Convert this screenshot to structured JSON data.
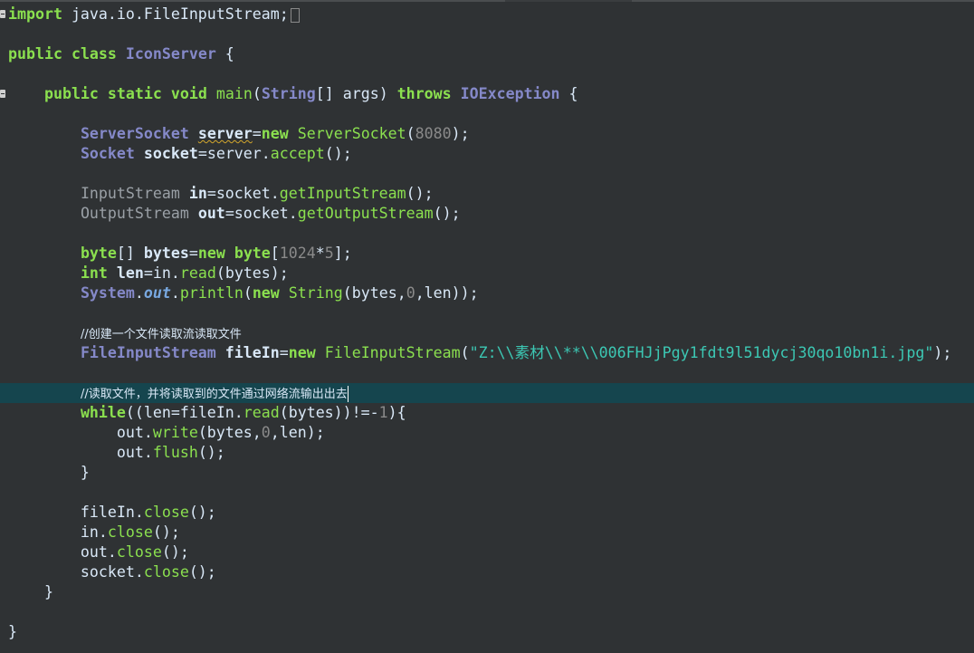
{
  "colors": {
    "background": "#2f3234",
    "keyword": "#8be04f",
    "type": "#8589c9",
    "string": "#3cc8b4",
    "current_line": "#15454e",
    "text": "#d9e8f7"
  },
  "editor": {
    "lines": [
      {
        "tokens": [
          {
            "t": "import",
            "c": "kw"
          },
          {
            "t": " java.io.FileInputStream;",
            "c": "id"
          }
        ],
        "collapsed": true,
        "fold": true
      },
      {
        "tokens": []
      },
      {
        "tokens": [
          {
            "t": "public",
            "c": "kw"
          },
          {
            "t": " ",
            "c": "id"
          },
          {
            "t": "class",
            "c": "kw"
          },
          {
            "t": " ",
            "c": "id"
          },
          {
            "t": "IconServer",
            "c": "typeb"
          },
          {
            "t": " {",
            "c": "id"
          }
        ]
      },
      {
        "tokens": []
      },
      {
        "tokens": [
          {
            "t": "    ",
            "c": "id"
          },
          {
            "t": "public",
            "c": "kw"
          },
          {
            "t": " ",
            "c": "id"
          },
          {
            "t": "static",
            "c": "kw"
          },
          {
            "t": " ",
            "c": "id"
          },
          {
            "t": "void",
            "c": "kw"
          },
          {
            "t": " ",
            "c": "id"
          },
          {
            "t": "main",
            "c": "meth"
          },
          {
            "t": "(",
            "c": "id"
          },
          {
            "t": "String",
            "c": "typeb"
          },
          {
            "t": "[] args) ",
            "c": "id"
          },
          {
            "t": "throws",
            "c": "kw"
          },
          {
            "t": " ",
            "c": "id"
          },
          {
            "t": "IOException",
            "c": "typeb"
          },
          {
            "t": " {",
            "c": "id"
          }
        ],
        "fold": true
      },
      {
        "tokens": []
      },
      {
        "tokens": [
          {
            "t": "        ",
            "c": "id"
          },
          {
            "t": "ServerSocket",
            "c": "typeb"
          },
          {
            "t": " ",
            "c": "id"
          },
          {
            "t": "server",
            "c": "idb",
            "squig": true
          },
          {
            "t": "=",
            "c": "id"
          },
          {
            "t": "new",
            "c": "kw"
          },
          {
            "t": " ",
            "c": "id"
          },
          {
            "t": "ServerSocket",
            "c": "meth"
          },
          {
            "t": "(",
            "c": "id"
          },
          {
            "t": "8080",
            "c": "num"
          },
          {
            "t": ");",
            "c": "id"
          }
        ]
      },
      {
        "tokens": [
          {
            "t": "        ",
            "c": "id"
          },
          {
            "t": "Socket",
            "c": "typeb"
          },
          {
            "t": " ",
            "c": "id"
          },
          {
            "t": "socket",
            "c": "idb"
          },
          {
            "t": "=server.",
            "c": "id"
          },
          {
            "t": "accept",
            "c": "meth"
          },
          {
            "t": "();",
            "c": "id"
          }
        ]
      },
      {
        "tokens": []
      },
      {
        "tokens": [
          {
            "t": "        ",
            "c": "id"
          },
          {
            "t": "InputStream",
            "c": "grey"
          },
          {
            "t": " ",
            "c": "id"
          },
          {
            "t": "in",
            "c": "idb"
          },
          {
            "t": "=socket.",
            "c": "id"
          },
          {
            "t": "getInputStream",
            "c": "meth"
          },
          {
            "t": "();",
            "c": "id"
          }
        ]
      },
      {
        "tokens": [
          {
            "t": "        ",
            "c": "id"
          },
          {
            "t": "OutputStream",
            "c": "grey"
          },
          {
            "t": " ",
            "c": "id"
          },
          {
            "t": "out",
            "c": "idb"
          },
          {
            "t": "=socket.",
            "c": "id"
          },
          {
            "t": "getOutputStream",
            "c": "meth"
          },
          {
            "t": "();",
            "c": "id"
          }
        ]
      },
      {
        "tokens": []
      },
      {
        "tokens": [
          {
            "t": "        ",
            "c": "id"
          },
          {
            "t": "byte",
            "c": "kw"
          },
          {
            "t": "[] ",
            "c": "id"
          },
          {
            "t": "bytes",
            "c": "idb"
          },
          {
            "t": "=",
            "c": "id"
          },
          {
            "t": "new",
            "c": "kw"
          },
          {
            "t": " ",
            "c": "id"
          },
          {
            "t": "byte",
            "c": "kw"
          },
          {
            "t": "[",
            "c": "id"
          },
          {
            "t": "1024",
            "c": "num"
          },
          {
            "t": "*",
            "c": "id"
          },
          {
            "t": "5",
            "c": "num"
          },
          {
            "t": "];",
            "c": "id"
          }
        ]
      },
      {
        "tokens": [
          {
            "t": "        ",
            "c": "id"
          },
          {
            "t": "int",
            "c": "kw"
          },
          {
            "t": " ",
            "c": "id"
          },
          {
            "t": "len",
            "c": "idb"
          },
          {
            "t": "=in.",
            "c": "id"
          },
          {
            "t": "read",
            "c": "meth"
          },
          {
            "t": "(bytes);",
            "c": "id"
          }
        ]
      },
      {
        "tokens": [
          {
            "t": "        ",
            "c": "id"
          },
          {
            "t": "System",
            "c": "typeb"
          },
          {
            "t": ".",
            "c": "id"
          },
          {
            "t": "out",
            "c": "field"
          },
          {
            "t": ".",
            "c": "id"
          },
          {
            "t": "println",
            "c": "meth"
          },
          {
            "t": "(",
            "c": "id"
          },
          {
            "t": "new",
            "c": "kw"
          },
          {
            "t": " ",
            "c": "id"
          },
          {
            "t": "String",
            "c": "meth"
          },
          {
            "t": "(bytes,",
            "c": "id"
          },
          {
            "t": "0",
            "c": "num"
          },
          {
            "t": ",len));",
            "c": "id"
          }
        ]
      },
      {
        "tokens": []
      },
      {
        "tokens": [
          {
            "t": "        ",
            "c": "id"
          },
          {
            "t": "//创建一个文件读取流读取文件",
            "c": "com"
          }
        ]
      },
      {
        "tokens": [
          {
            "t": "        ",
            "c": "id"
          },
          {
            "t": "FileInputStream",
            "c": "typeb"
          },
          {
            "t": " ",
            "c": "id"
          },
          {
            "t": "fileIn",
            "c": "idb"
          },
          {
            "t": "=",
            "c": "id"
          },
          {
            "t": "new",
            "c": "kw"
          },
          {
            "t": " ",
            "c": "id"
          },
          {
            "t": "FileInputStream",
            "c": "meth"
          },
          {
            "t": "(",
            "c": "id"
          },
          {
            "t": "\"Z:\\\\素材\\\\**\\\\006FHJjPgy1fdt9l51dycj30qo10bn1i.jpg\"",
            "c": "str"
          },
          {
            "t": ");",
            "c": "id"
          }
        ]
      },
      {
        "tokens": []
      },
      {
        "tokens": [
          {
            "t": "        ",
            "c": "id"
          },
          {
            "t": "//读取文件，并将读取到的文件通过网络流输出出去",
            "c": "com"
          }
        ],
        "current": true,
        "caret": true
      },
      {
        "tokens": [
          {
            "t": "        ",
            "c": "id"
          },
          {
            "t": "while",
            "c": "kw"
          },
          {
            "t": "((len=fileIn.",
            "c": "id"
          },
          {
            "t": "read",
            "c": "meth"
          },
          {
            "t": "(bytes))!=-",
            "c": "id"
          },
          {
            "t": "1",
            "c": "num"
          },
          {
            "t": "){",
            "c": "id"
          }
        ]
      },
      {
        "tokens": [
          {
            "t": "            out.",
            "c": "id"
          },
          {
            "t": "write",
            "c": "meth"
          },
          {
            "t": "(bytes,",
            "c": "id"
          },
          {
            "t": "0",
            "c": "num"
          },
          {
            "t": ",len);",
            "c": "id"
          }
        ]
      },
      {
        "tokens": [
          {
            "t": "            out.",
            "c": "id"
          },
          {
            "t": "flush",
            "c": "meth"
          },
          {
            "t": "();",
            "c": "id"
          }
        ]
      },
      {
        "tokens": [
          {
            "t": "        }",
            "c": "id"
          }
        ]
      },
      {
        "tokens": []
      },
      {
        "tokens": [
          {
            "t": "        fileIn.",
            "c": "id"
          },
          {
            "t": "close",
            "c": "meth"
          },
          {
            "t": "();",
            "c": "id"
          }
        ]
      },
      {
        "tokens": [
          {
            "t": "        in.",
            "c": "id"
          },
          {
            "t": "close",
            "c": "meth"
          },
          {
            "t": "();",
            "c": "id"
          }
        ]
      },
      {
        "tokens": [
          {
            "t": "        out.",
            "c": "id"
          },
          {
            "t": "close",
            "c": "meth"
          },
          {
            "t": "();",
            "c": "id"
          }
        ]
      },
      {
        "tokens": [
          {
            "t": "        socket.",
            "c": "id"
          },
          {
            "t": "close",
            "c": "meth"
          },
          {
            "t": "();",
            "c": "id"
          }
        ]
      },
      {
        "tokens": [
          {
            "t": "    }",
            "c": "id"
          }
        ]
      },
      {
        "tokens": []
      },
      {
        "tokens": [
          {
            "t": "}",
            "c": "id"
          }
        ]
      }
    ]
  }
}
